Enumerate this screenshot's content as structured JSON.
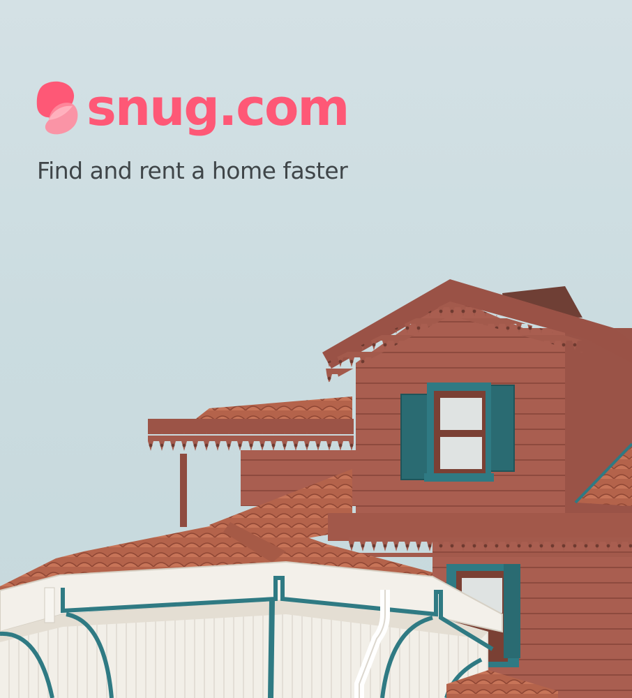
{
  "brand": {
    "name": "snug.com",
    "tagline": "Find and rent a home faster",
    "logo_icon": "snug-logo-icon"
  },
  "colors": {
    "brand": "#fe5876",
    "tagline": "#3f4548",
    "sky": "#cbdce0",
    "wall": "#a85d4f",
    "roof": "#b8644d",
    "trim": "#2f7a83",
    "white": "#f1efe9"
  },
  "background_image": "house-photo"
}
